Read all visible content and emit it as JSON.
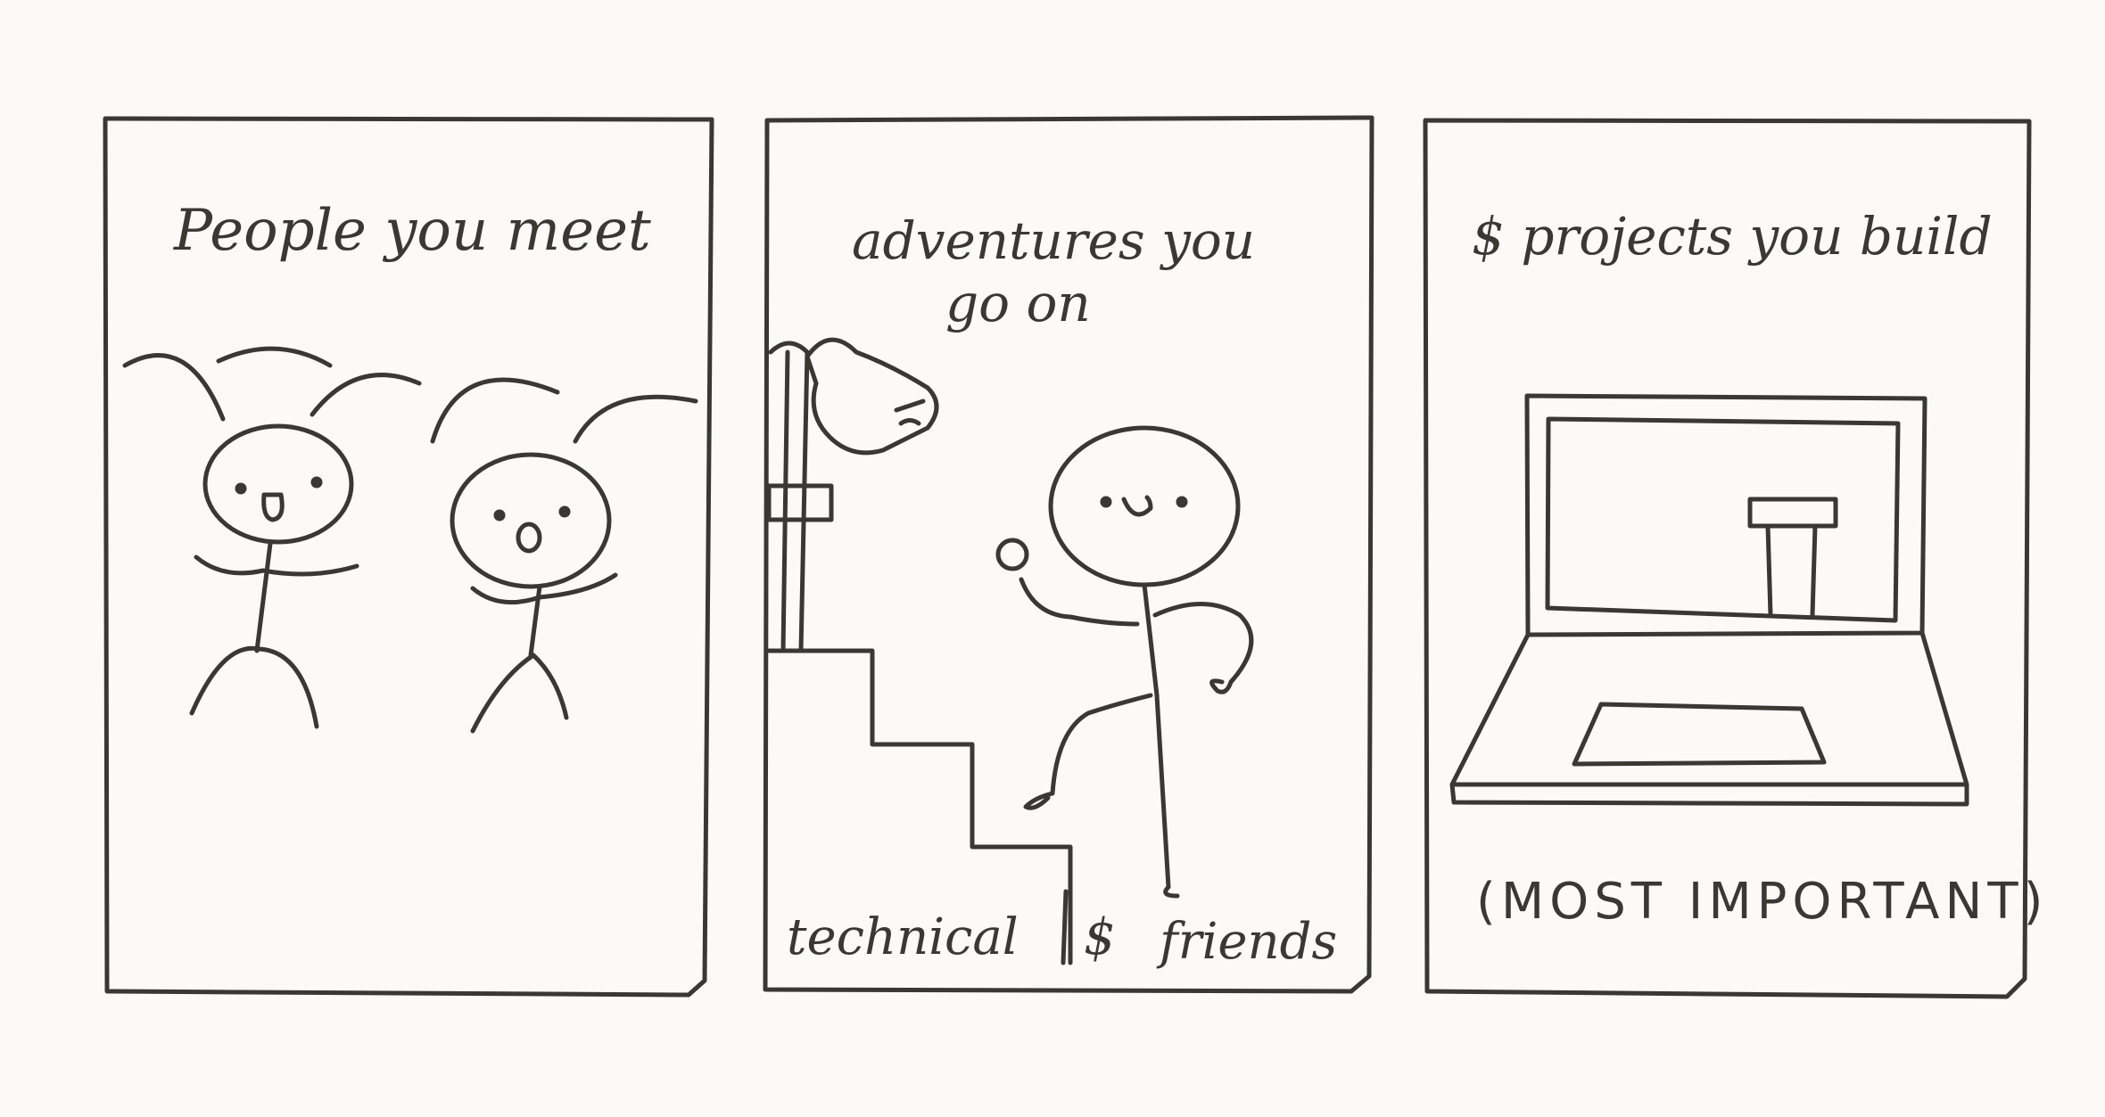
{
  "panels": [
    {
      "caption": "People you meet"
    },
    {
      "caption_line1": "adventures you",
      "caption_line2": "go on",
      "label_left": "technical",
      "label_amp": "$",
      "label_right": "friends"
    },
    {
      "caption": "$ projects you build",
      "note": "(MOST IMPORTANT)"
    }
  ],
  "colors": {
    "ink": "#3a3835",
    "paper": "#fbfaf8"
  }
}
